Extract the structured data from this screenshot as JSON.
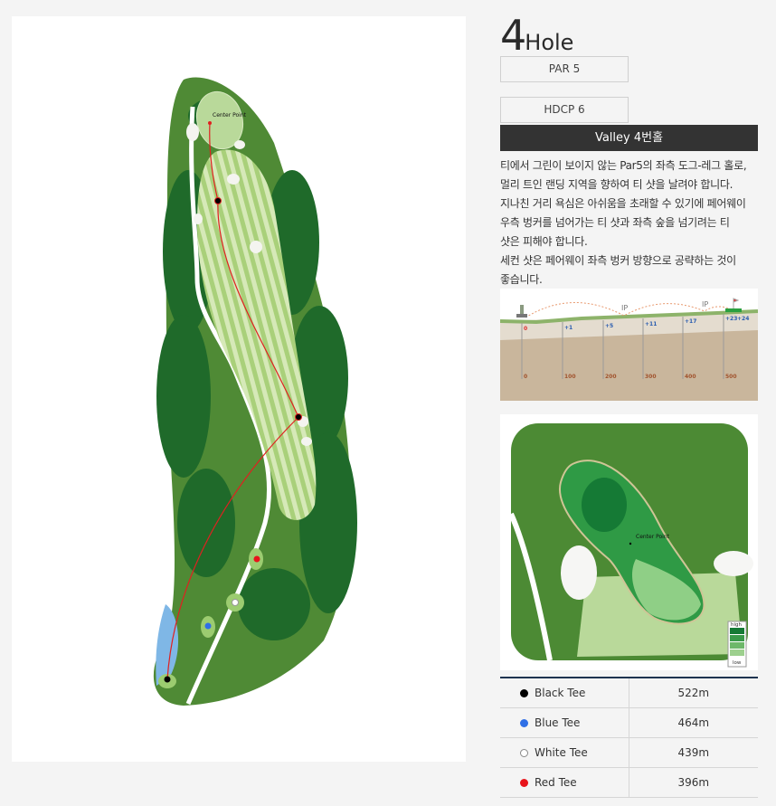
{
  "hole": {
    "number": "4",
    "suffix": "Hole",
    "par": "PAR 5",
    "hdcp": "HDCP 6",
    "name": "Valley 4번홀"
  },
  "description": [
    "티에서 그린이 보이지 않는 Par5의 좌측 도그-레그 홀로,",
    "멀리 트인 랜딩 지역을 향하여 티 샷을 날려야 합니다.",
    "지나친 거리 욕심은 아쉬움을 초래할 수 있기에 페어웨이",
    "우측 벙커를 넘어가는 티 샷과 좌측 숲을 넘기려는 티",
    "샷은 피해야 합니다.",
    "세컨 샷은 페어웨이 좌측 벙커 방향으로 공략하는 것이",
    "좋습니다."
  ],
  "map": {
    "center_label": "Center Point"
  },
  "profile": {
    "distances": [
      "0",
      "100",
      "200",
      "300",
      "400",
      "500"
    ],
    "elevations": [
      "0",
      "+1",
      "+5",
      "+11",
      "+17",
      "+23",
      "+24"
    ],
    "ip_label": "IP"
  },
  "green_detail": {
    "center_label": "Center Point",
    "legend_high": "high",
    "legend_low": "low"
  },
  "tees": [
    {
      "name": "Black Tee",
      "distance": "522m",
      "color": "#000000"
    },
    {
      "name": "Blue Tee",
      "distance": "464m",
      "color": "#2f6fe6"
    },
    {
      "name": "White Tee",
      "distance": "439m",
      "color": "#ffffff"
    },
    {
      "name": "Red Tee",
      "distance": "396m",
      "color": "#e8141b"
    }
  ]
}
